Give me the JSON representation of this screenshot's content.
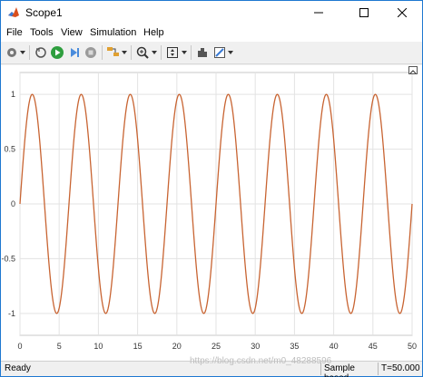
{
  "window": {
    "title": "Scope1",
    "controls": [
      "minimize",
      "maximize",
      "close"
    ]
  },
  "menubar": {
    "items": [
      "File",
      "Tools",
      "View",
      "Simulation",
      "Help"
    ]
  },
  "toolbar": {
    "buttons": [
      "settings-icon",
      "restore-icon",
      "run-icon",
      "step-forward-icon",
      "stop-icon",
      "highlight-icon",
      "zoom-in-icon",
      "scale-axes-icon",
      "cursor-measure-icon",
      "style-icon"
    ]
  },
  "chart_data": {
    "type": "line",
    "title": "",
    "xlabel": "",
    "ylabel": "",
    "xlim": [
      0,
      50
    ],
    "ylim": [
      -1.2,
      1.2
    ],
    "x_ticks": [
      "0",
      "5",
      "10",
      "15",
      "20",
      "25",
      "30",
      "35",
      "40",
      "45",
      "50"
    ],
    "y_ticks": [
      "1",
      "0.5",
      "0",
      "-0.5",
      "-1"
    ],
    "grid": true,
    "series": [
      {
        "function": "sin",
        "amplitude": 1,
        "period": 6.25,
        "phase": 0,
        "x_start": 0,
        "x_end": 50,
        "color": "#c86432"
      }
    ]
  },
  "statusbar": {
    "ready": "Ready",
    "mode": "Sample based",
    "time": "T=50.000"
  },
  "watermark": "https://blog.csdn.net/m0_48288596"
}
